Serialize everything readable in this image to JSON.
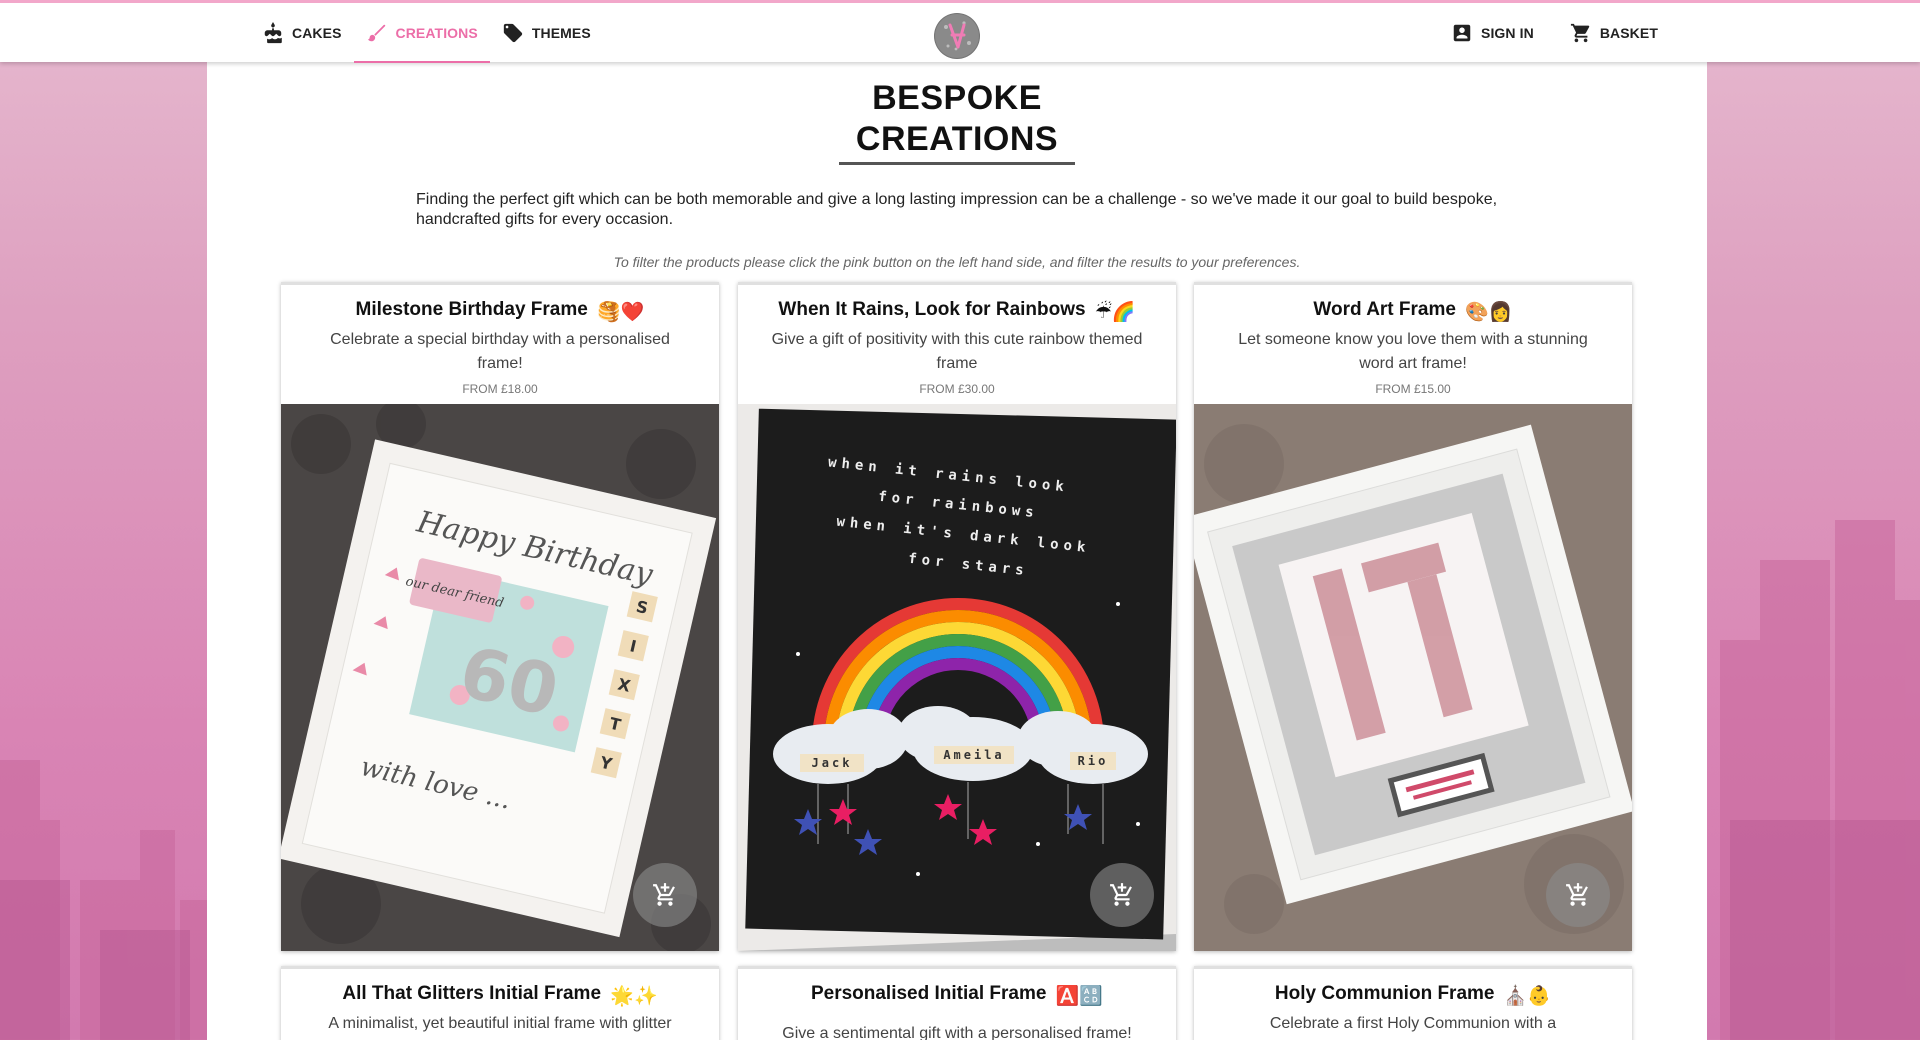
{
  "nav": {
    "left": [
      {
        "label": "CAKES",
        "icon": "cake-icon",
        "active": false
      },
      {
        "label": "CREATIONS",
        "icon": "brush-icon",
        "active": true
      },
      {
        "label": "THEMES",
        "icon": "tag-icon",
        "active": false
      }
    ],
    "right": [
      {
        "label": "SIGN IN",
        "icon": "account-box-icon"
      },
      {
        "label": "BASKET",
        "icon": "cart-icon"
      }
    ]
  },
  "page": {
    "title": "BESPOKE CREATIONS",
    "intro": "Finding the perfect gift which can be both memorable and give a long lasting impression can be a challenge - so we've made it our goal to build bespoke, handcrafted gifts for every occasion.",
    "filter_hint": "To filter the products please click the pink button on the left hand side, and filter the results to your preferences."
  },
  "products": [
    {
      "title": "Milestone Birthday Frame",
      "emoji": "🥞❤️",
      "description": "Celebrate a special birthday with a personalised frame!",
      "price": "FROM £18.00"
    },
    {
      "title": "When It Rains, Look for Rainbows",
      "emoji": "☔🌈",
      "description": "Give a gift of positivity with this cute rainbow themed frame",
      "price": "FROM £30.00"
    },
    {
      "title": "Word Art Frame",
      "emoji": "🎨👩",
      "description": "Let someone know you love them with a stunning word art frame!",
      "price": "FROM £15.00"
    },
    {
      "title": "All That Glitters Initial Frame",
      "emoji": "🌟✨",
      "description": "A minimalist, yet beautiful initial frame with glitter",
      "price": ""
    },
    {
      "title": "Personalised Initial Frame",
      "emoji": "🅰️🔠",
      "description": "Give a sentimental gift with a personalised frame!",
      "price": ""
    },
    {
      "title": "Holy Communion Frame",
      "emoji": "⛪👶",
      "description": "Celebrate a first Holy Communion with a",
      "price": ""
    }
  ],
  "image_text": {
    "birthday": {
      "line1": "Happy Birthday",
      "tag": "our dear friend",
      "number": "60",
      "footer": "with love ...",
      "tiles": [
        "S",
        "I",
        "X",
        "T",
        "Y"
      ]
    },
    "rainbow": {
      "lines": [
        "when it rains look",
        "for rainbows",
        "when it's dark look",
        "for stars"
      ],
      "names": [
        "Jack",
        "Ameila",
        "Rio"
      ]
    }
  },
  "colors": {
    "accent": "#ec6ea8",
    "nav_border": "#f2a7ca"
  }
}
